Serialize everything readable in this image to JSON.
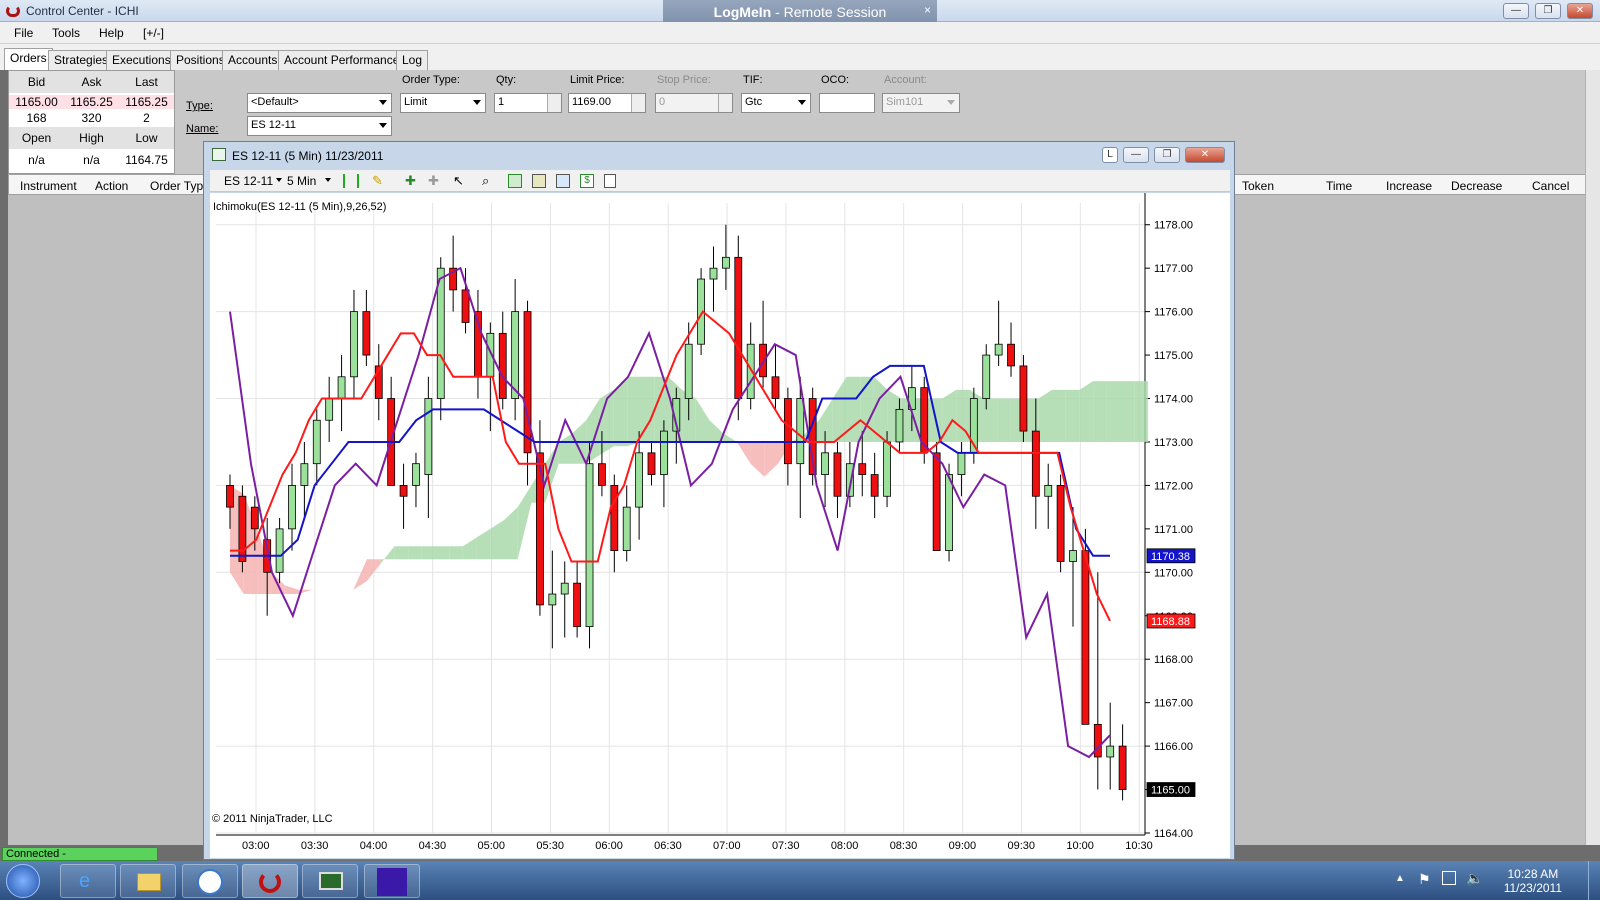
{
  "window": {
    "title": "Control Center - ICHI",
    "remote_banner_brand": "LogMeIn",
    "remote_banner_text": " - Remote Session",
    "remote_close": "×"
  },
  "menu": [
    "File",
    "Tools",
    "Help",
    "[+/-]"
  ],
  "tabs": [
    "Orders",
    "Strategies",
    "Executions",
    "Positions",
    "Accounts",
    "Account Performance",
    "Log"
  ],
  "quote": {
    "headers1": [
      "Bid",
      "Ask",
      "Last"
    ],
    "values1": [
      "1165.00",
      "1165.25",
      "1165.25"
    ],
    "sizes1": [
      "168",
      "320",
      "2"
    ],
    "headers2": [
      "Open",
      "High",
      "Low"
    ],
    "values2": [
      "n/a",
      "n/a",
      "1164.75"
    ]
  },
  "order_form": {
    "labels": {
      "type": "Type:",
      "name": "Name:",
      "order_type": "Order Type:",
      "qty": "Qty:",
      "limit_price": "Limit Price:",
      "stop_price": "Stop Price:",
      "tif": "TIF:",
      "oco": "OCO:",
      "account": "Account:"
    },
    "type_value": "<Default>",
    "name_value": "ES 12-11",
    "order_type_value": "Limit",
    "qty_value": "1",
    "limit_price_value": "1169.00",
    "stop_price_value": "0",
    "tif_value": "Gtc",
    "oco_value": "",
    "account_value": "Sim101"
  },
  "grid_headers_left": [
    "Instrument",
    "Action",
    "Order Typ"
  ],
  "grid_headers_right": [
    "Token",
    "Time",
    "Increase",
    "Decrease",
    "Cancel"
  ],
  "status": {
    "connection": "Connected - InteractiveBrokers"
  },
  "chart_window": {
    "title": "ES 12-11 (5 Min)  11/23/2011",
    "toolbar_instrument": "ES 12-11",
    "toolbar_interval": "5 Min",
    "indicator_label": "Ichimoku(ES 12-11 (5 Min),9,26,52)",
    "copyright": "© 2011 NinjaTrader, LLC",
    "l_button": "L"
  },
  "chart_data": {
    "type": "candlestick",
    "instrument": "ES 12-11",
    "interval": "5 Min",
    "date": "11/23/2011",
    "ylim": [
      1164.0,
      1178.5
    ],
    "y_ticks": [
      "1164.00",
      "1165.00",
      "1166.00",
      "1167.00",
      "1168.00",
      "1169.00",
      "1170.00",
      "1171.00",
      "1172.00",
      "1173.00",
      "1174.00",
      "1175.00",
      "1176.00",
      "1177.00",
      "1178.00"
    ],
    "x_ticks": [
      "03:00",
      "03:30",
      "04:00",
      "04:30",
      "05:00",
      "05:30",
      "06:00",
      "06:30",
      "07:00",
      "07:30",
      "08:00",
      "08:30",
      "09:00",
      "09:30",
      "10:00",
      "10:30"
    ],
    "last_price_labels": {
      "kijun": "1170.38",
      "tenkan": "1168.88",
      "close": "1165.00"
    },
    "candles": [
      [
        1172.0,
        1172.25,
        1171.0,
        1171.5
      ],
      [
        1171.75,
        1172.0,
        1170.0,
        1170.25
      ],
      [
        1171.5,
        1171.75,
        1170.5,
        1171.0
      ],
      [
        1170.75,
        1171.25,
        1169.0,
        1170.0
      ],
      [
        1170.0,
        1171.25,
        1169.75,
        1171.0
      ],
      [
        1171.0,
        1172.5,
        1170.5,
        1172.0
      ],
      [
        1172.0,
        1173.0,
        1171.25,
        1172.5
      ],
      [
        1172.5,
        1173.75,
        1172.0,
        1173.5
      ],
      [
        1173.5,
        1174.5,
        1173.0,
        1174.0
      ],
      [
        1174.0,
        1175.0,
        1173.25,
        1174.5
      ],
      [
        1174.5,
        1176.5,
        1174.0,
        1176.0
      ],
      [
        1176.0,
        1176.5,
        1174.75,
        1175.0
      ],
      [
        1174.75,
        1175.25,
        1173.5,
        1174.0
      ],
      [
        1174.0,
        1174.5,
        1172.5,
        1172.0
      ],
      [
        1172.0,
        1172.5,
        1171.0,
        1171.75
      ],
      [
        1172.0,
        1172.75,
        1171.5,
        1172.5
      ],
      [
        1172.25,
        1174.5,
        1171.25,
        1174.0
      ],
      [
        1174.0,
        1177.25,
        1173.5,
        1177.0
      ],
      [
        1177.0,
        1177.75,
        1176.0,
        1176.5
      ],
      [
        1176.5,
        1177.0,
        1175.5,
        1175.75
      ],
      [
        1176.0,
        1176.5,
        1174.0,
        1174.5
      ],
      [
        1174.5,
        1175.75,
        1173.25,
        1175.5
      ],
      [
        1175.5,
        1176.0,
        1173.75,
        1174.0
      ],
      [
        1174.0,
        1176.75,
        1173.5,
        1176.0
      ],
      [
        1176.0,
        1176.25,
        1172.0,
        1172.75
      ],
      [
        1172.75,
        1173.5,
        1169.0,
        1169.25
      ],
      [
        1169.25,
        1170.5,
        1168.25,
        1169.5
      ],
      [
        1169.5,
        1170.25,
        1168.5,
        1169.75
      ],
      [
        1169.75,
        1170.25,
        1168.5,
        1168.75
      ],
      [
        1168.75,
        1173.0,
        1168.25,
        1172.5
      ],
      [
        1172.5,
        1173.25,
        1171.75,
        1172.0
      ],
      [
        1172.0,
        1172.25,
        1170.0,
        1170.5
      ],
      [
        1170.5,
        1172.0,
        1170.25,
        1171.5
      ],
      [
        1171.5,
        1173.25,
        1170.75,
        1172.75
      ],
      [
        1172.75,
        1173.0,
        1172.0,
        1172.25
      ],
      [
        1172.25,
        1173.5,
        1171.5,
        1173.25
      ],
      [
        1173.25,
        1174.25,
        1172.5,
        1174.0
      ],
      [
        1174.0,
        1175.75,
        1173.5,
        1175.25
      ],
      [
        1175.25,
        1177.0,
        1175.0,
        1176.75
      ],
      [
        1176.75,
        1177.5,
        1176.0,
        1177.0
      ],
      [
        1177.0,
        1178.0,
        1176.5,
        1177.25
      ],
      [
        1177.25,
        1177.75,
        1173.5,
        1174.0
      ],
      [
        1174.0,
        1175.75,
        1173.75,
        1175.25
      ],
      [
        1175.25,
        1176.25,
        1174.25,
        1174.5
      ],
      [
        1174.5,
        1175.25,
        1173.75,
        1174.0
      ],
      [
        1174.0,
        1174.25,
        1172.0,
        1172.5
      ],
      [
        1172.5,
        1174.5,
        1171.25,
        1174.0
      ],
      [
        1174.0,
        1174.25,
        1172.0,
        1172.25
      ],
      [
        1172.25,
        1173.25,
        1171.5,
        1172.75
      ],
      [
        1172.75,
        1173.0,
        1171.25,
        1171.75
      ],
      [
        1171.75,
        1173.0,
        1171.5,
        1172.5
      ],
      [
        1172.5,
        1173.25,
        1171.75,
        1172.25
      ],
      [
        1172.25,
        1172.75,
        1171.25,
        1171.75
      ],
      [
        1171.75,
        1173.25,
        1171.5,
        1173.0
      ],
      [
        1173.0,
        1174.0,
        1172.75,
        1173.75
      ],
      [
        1173.75,
        1174.75,
        1173.25,
        1174.25
      ],
      [
        1174.25,
        1174.5,
        1172.5,
        1172.75
      ],
      [
        1172.75,
        1173.0,
        1170.5,
        1170.5
      ],
      [
        1170.5,
        1172.5,
        1170.25,
        1172.25
      ],
      [
        1172.25,
        1173.0,
        1171.75,
        1172.75
      ],
      [
        1172.75,
        1174.25,
        1172.5,
        1174.0
      ],
      [
        1174.0,
        1175.25,
        1173.75,
        1175.0
      ],
      [
        1175.0,
        1176.25,
        1174.75,
        1175.25
      ],
      [
        1175.25,
        1175.75,
        1174.5,
        1174.75
      ],
      [
        1174.75,
        1175.0,
        1173.0,
        1173.25
      ],
      [
        1173.25,
        1174.0,
        1171.0,
        1171.75
      ],
      [
        1171.75,
        1172.5,
        1171.0,
        1172.0
      ],
      [
        1172.0,
        1172.25,
        1170.0,
        1170.25
      ],
      [
        1170.25,
        1171.5,
        1168.75,
        1170.5
      ],
      [
        1170.5,
        1171.0,
        1166.75,
        1166.5
      ],
      [
        1166.5,
        1170.0,
        1165.0,
        1165.75
      ],
      [
        1165.75,
        1167.0,
        1165.0,
        1166.0
      ],
      [
        1166.0,
        1166.5,
        1164.75,
        1165.0
      ]
    ],
    "tenkan": [
      1170.5,
      1170.5,
      1170.75,
      1171.5,
      1172.25,
      1172.75,
      1173.5,
      1174.0,
      1174.0,
      1174.0,
      1174.0,
      1174.5,
      1175.0,
      1175.5,
      1175.5,
      1175.0,
      1175.0,
      1174.5,
      1174.5,
      1174.5,
      1174.5,
      1173.0,
      1172.5,
      1172.5,
      1172.5,
      1171.0,
      1170.25,
      1170.25,
      1170.25,
      1171.5,
      1172.0,
      1173.0,
      1173.5,
      1174.25,
      1175.0,
      1175.5,
      1176.0,
      1175.75,
      1175.5,
      1175.0,
      1174.5,
      1174.0,
      1173.5,
      1173.25,
      1173.0,
      1173.0,
      1173.0,
      1173.25,
      1173.5,
      1173.25,
      1173.0,
      1172.75,
      1172.75,
      1172.75,
      1173.0,
      1173.5,
      1173.25,
      1172.75,
      1172.75,
      1172.75,
      1172.75,
      1172.75,
      1172.75,
      1172.75,
      1171.5,
      1170.5,
      1169.5,
      1168.88
    ],
    "kijun": [
      1170.38,
      1170.38,
      1170.38,
      1170.38,
      1170.75,
      1172.0,
      1172.5,
      1173.0,
      1173.0,
      1173.0,
      1173.0,
      1173.5,
      1173.75,
      1173.75,
      1173.75,
      1173.75,
      1173.5,
      1173.25,
      1173.0,
      1173.0,
      1173.0,
      1173.0,
      1173.0,
      1173.0,
      1173.0,
      1173.0,
      1173.0,
      1173.0,
      1173.0,
      1173.0,
      1173.0,
      1173.0,
      1173.0,
      1173.0,
      1173.0,
      1174.0,
      1174.0,
      1174.0,
      1174.5,
      1174.75,
      1174.75,
      1174.75,
      1173.0,
      1172.75,
      1172.75,
      1172.75,
      1172.75,
      1172.75,
      1172.75,
      1172.75,
      1171.0,
      1170.38,
      1170.38
    ],
    "chikou": [
      1176.0,
      1172.5,
      1170.0,
      1169.0,
      1170.5,
      1172.0,
      1172.5,
      1172.0,
      1173.5,
      1175.0,
      1176.75,
      1177.0,
      1175.5,
      1174.5,
      1174.0,
      1172.0,
      1173.5,
      1172.5,
      1174.0,
      1174.5,
      1175.5,
      1174.0,
      1172.0,
      1172.5,
      1173.75,
      1174.5,
      1175.25,
      1175.0,
      1172.0,
      1170.5,
      1173.0,
      1174.0,
      1174.5,
      1173.0,
      1172.5,
      1171.5,
      1172.25,
      1172.0,
      1168.5,
      1169.5,
      1166.0,
      1165.75,
      1166.25
    ]
  }
}
